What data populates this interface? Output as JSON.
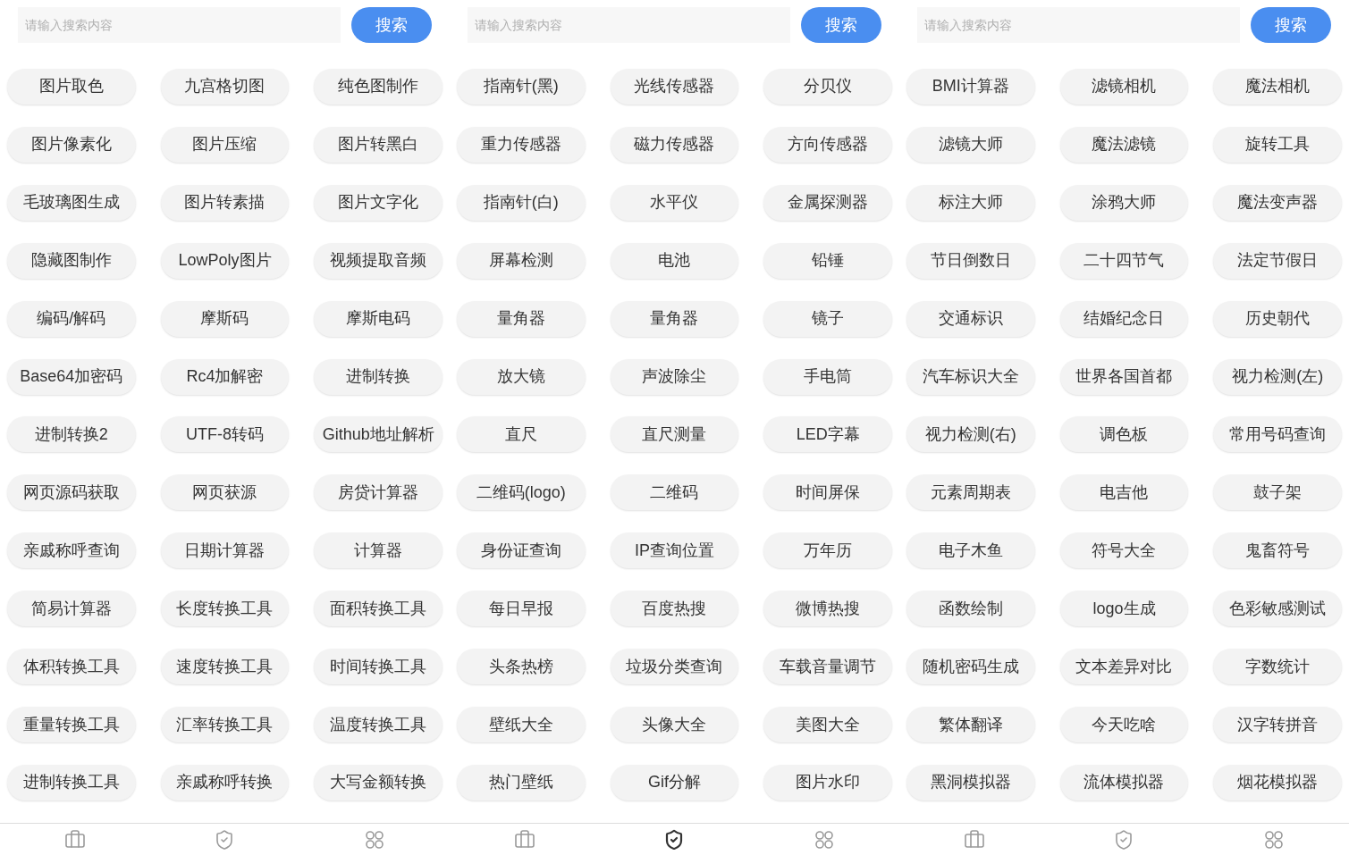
{
  "panels": [
    {
      "search": {
        "placeholder": "请输入搜索内容",
        "button": "搜索"
      },
      "items": [
        "图片取色",
        "九宫格切图",
        "纯色图制作",
        "图片像素化",
        "图片压缩",
        "图片转黑白",
        "毛玻璃图生成",
        "图片转素描",
        "图片文字化",
        "隐藏图制作",
        "LowPoly图片",
        "视频提取音频",
        "编码/解码",
        "摩斯码",
        "摩斯电码",
        "Base64加密码",
        "Rc4加解密",
        "进制转换",
        "进制转换2",
        "UTF-8转码",
        "Github地址解析",
        "网页源码获取",
        "网页获源",
        "房贷计算器",
        "亲戚称呼查询",
        "日期计算器",
        "计算器",
        "简易计算器",
        "长度转换工具",
        "面积转换工具",
        "体积转换工具",
        "速度转换工具",
        "时间转换工具",
        "重量转换工具",
        "汇率转换工具",
        "温度转换工具",
        "进制转换工具",
        "亲戚称呼转换",
        "大写金额转换"
      ],
      "nav": [
        {
          "kind": "briefcase",
          "selected": false
        },
        {
          "kind": "shield",
          "selected": false
        },
        {
          "kind": "apps",
          "selected": false
        }
      ]
    },
    {
      "search": {
        "placeholder": "请输入搜索内容",
        "button": "搜索"
      },
      "items": [
        "指南针(黑)",
        "光线传感器",
        "分贝仪",
        "重力传感器",
        "磁力传感器",
        "方向传感器",
        "指南针(白)",
        "水平仪",
        "金属探测器",
        "屏幕检测",
        "电池",
        "铅锤",
        "量角器",
        "量角器",
        "镜子",
        "放大镜",
        "声波除尘",
        "手电筒",
        "直尺",
        "直尺测量",
        "LED字幕",
        "二维码(logo)",
        "二维码",
        "时间屏保",
        "身份证查询",
        "IP查询位置",
        "万年历",
        "每日早报",
        "百度热搜",
        "微博热搜",
        "头条热榜",
        "垃圾分类查询",
        "车载音量调节",
        "壁纸大全",
        "头像大全",
        "美图大全",
        "热门壁纸",
        "Gif分解",
        "图片水印"
      ],
      "nav": [
        {
          "kind": "briefcase",
          "selected": false
        },
        {
          "kind": "shield",
          "selected": true
        },
        {
          "kind": "apps",
          "selected": false
        }
      ]
    },
    {
      "search": {
        "placeholder": "请输入搜索内容",
        "button": "搜索"
      },
      "items": [
        "BMI计算器",
        "滤镜相机",
        "魔法相机",
        "滤镜大师",
        "魔法滤镜",
        "旋转工具",
        "标注大师",
        "涂鸦大师",
        "魔法变声器",
        "节日倒数日",
        "二十四节气",
        "法定节假日",
        "交通标识",
        "结婚纪念日",
        "历史朝代",
        "汽车标识大全",
        "世界各国首都",
        "视力检测(左)",
        "视力检测(右)",
        "调色板",
        "常用号码查询",
        "元素周期表",
        "电吉他",
        "鼓子架",
        "电子木鱼",
        "符号大全",
        "鬼畜符号",
        "函数绘制",
        "logo生成",
        "色彩敏感测试",
        "随机密码生成",
        "文本差异对比",
        "字数统计",
        "繁体翻译",
        "今天吃啥",
        "汉字转拼音",
        "黑洞模拟器",
        "流体模拟器",
        "烟花模拟器"
      ],
      "nav": [
        {
          "kind": "briefcase",
          "selected": false
        },
        {
          "kind": "shield",
          "selected": false
        },
        {
          "kind": "apps",
          "selected": false
        }
      ]
    }
  ]
}
